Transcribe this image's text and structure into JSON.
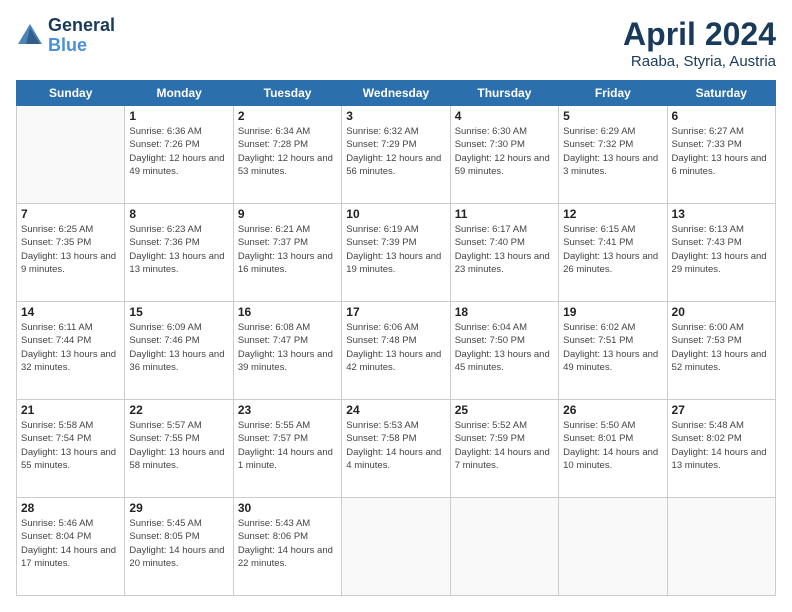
{
  "header": {
    "logo_line1": "General",
    "logo_line2": "Blue",
    "month_title": "April 2024",
    "location": "Raaba, Styria, Austria"
  },
  "weekdays": [
    "Sunday",
    "Monday",
    "Tuesday",
    "Wednesday",
    "Thursday",
    "Friday",
    "Saturday"
  ],
  "weeks": [
    [
      {
        "day": null
      },
      {
        "day": "1",
        "sunrise": "Sunrise: 6:36 AM",
        "sunset": "Sunset: 7:26 PM",
        "daylight": "Daylight: 12 hours and 49 minutes."
      },
      {
        "day": "2",
        "sunrise": "Sunrise: 6:34 AM",
        "sunset": "Sunset: 7:28 PM",
        "daylight": "Daylight: 12 hours and 53 minutes."
      },
      {
        "day": "3",
        "sunrise": "Sunrise: 6:32 AM",
        "sunset": "Sunset: 7:29 PM",
        "daylight": "Daylight: 12 hours and 56 minutes."
      },
      {
        "day": "4",
        "sunrise": "Sunrise: 6:30 AM",
        "sunset": "Sunset: 7:30 PM",
        "daylight": "Daylight: 12 hours and 59 minutes."
      },
      {
        "day": "5",
        "sunrise": "Sunrise: 6:29 AM",
        "sunset": "Sunset: 7:32 PM",
        "daylight": "Daylight: 13 hours and 3 minutes."
      },
      {
        "day": "6",
        "sunrise": "Sunrise: 6:27 AM",
        "sunset": "Sunset: 7:33 PM",
        "daylight": "Daylight: 13 hours and 6 minutes."
      }
    ],
    [
      {
        "day": "7",
        "sunrise": "Sunrise: 6:25 AM",
        "sunset": "Sunset: 7:35 PM",
        "daylight": "Daylight: 13 hours and 9 minutes."
      },
      {
        "day": "8",
        "sunrise": "Sunrise: 6:23 AM",
        "sunset": "Sunset: 7:36 PM",
        "daylight": "Daylight: 13 hours and 13 minutes."
      },
      {
        "day": "9",
        "sunrise": "Sunrise: 6:21 AM",
        "sunset": "Sunset: 7:37 PM",
        "daylight": "Daylight: 13 hours and 16 minutes."
      },
      {
        "day": "10",
        "sunrise": "Sunrise: 6:19 AM",
        "sunset": "Sunset: 7:39 PM",
        "daylight": "Daylight: 13 hours and 19 minutes."
      },
      {
        "day": "11",
        "sunrise": "Sunrise: 6:17 AM",
        "sunset": "Sunset: 7:40 PM",
        "daylight": "Daylight: 13 hours and 23 minutes."
      },
      {
        "day": "12",
        "sunrise": "Sunrise: 6:15 AM",
        "sunset": "Sunset: 7:41 PM",
        "daylight": "Daylight: 13 hours and 26 minutes."
      },
      {
        "day": "13",
        "sunrise": "Sunrise: 6:13 AM",
        "sunset": "Sunset: 7:43 PM",
        "daylight": "Daylight: 13 hours and 29 minutes."
      }
    ],
    [
      {
        "day": "14",
        "sunrise": "Sunrise: 6:11 AM",
        "sunset": "Sunset: 7:44 PM",
        "daylight": "Daylight: 13 hours and 32 minutes."
      },
      {
        "day": "15",
        "sunrise": "Sunrise: 6:09 AM",
        "sunset": "Sunset: 7:46 PM",
        "daylight": "Daylight: 13 hours and 36 minutes."
      },
      {
        "day": "16",
        "sunrise": "Sunrise: 6:08 AM",
        "sunset": "Sunset: 7:47 PM",
        "daylight": "Daylight: 13 hours and 39 minutes."
      },
      {
        "day": "17",
        "sunrise": "Sunrise: 6:06 AM",
        "sunset": "Sunset: 7:48 PM",
        "daylight": "Daylight: 13 hours and 42 minutes."
      },
      {
        "day": "18",
        "sunrise": "Sunrise: 6:04 AM",
        "sunset": "Sunset: 7:50 PM",
        "daylight": "Daylight: 13 hours and 45 minutes."
      },
      {
        "day": "19",
        "sunrise": "Sunrise: 6:02 AM",
        "sunset": "Sunset: 7:51 PM",
        "daylight": "Daylight: 13 hours and 49 minutes."
      },
      {
        "day": "20",
        "sunrise": "Sunrise: 6:00 AM",
        "sunset": "Sunset: 7:53 PM",
        "daylight": "Daylight: 13 hours and 52 minutes."
      }
    ],
    [
      {
        "day": "21",
        "sunrise": "Sunrise: 5:58 AM",
        "sunset": "Sunset: 7:54 PM",
        "daylight": "Daylight: 13 hours and 55 minutes."
      },
      {
        "day": "22",
        "sunrise": "Sunrise: 5:57 AM",
        "sunset": "Sunset: 7:55 PM",
        "daylight": "Daylight: 13 hours and 58 minutes."
      },
      {
        "day": "23",
        "sunrise": "Sunrise: 5:55 AM",
        "sunset": "Sunset: 7:57 PM",
        "daylight": "Daylight: 14 hours and 1 minute."
      },
      {
        "day": "24",
        "sunrise": "Sunrise: 5:53 AM",
        "sunset": "Sunset: 7:58 PM",
        "daylight": "Daylight: 14 hours and 4 minutes."
      },
      {
        "day": "25",
        "sunrise": "Sunrise: 5:52 AM",
        "sunset": "Sunset: 7:59 PM",
        "daylight": "Daylight: 14 hours and 7 minutes."
      },
      {
        "day": "26",
        "sunrise": "Sunrise: 5:50 AM",
        "sunset": "Sunset: 8:01 PM",
        "daylight": "Daylight: 14 hours and 10 minutes."
      },
      {
        "day": "27",
        "sunrise": "Sunrise: 5:48 AM",
        "sunset": "Sunset: 8:02 PM",
        "daylight": "Daylight: 14 hours and 13 minutes."
      }
    ],
    [
      {
        "day": "28",
        "sunrise": "Sunrise: 5:46 AM",
        "sunset": "Sunset: 8:04 PM",
        "daylight": "Daylight: 14 hours and 17 minutes."
      },
      {
        "day": "29",
        "sunrise": "Sunrise: 5:45 AM",
        "sunset": "Sunset: 8:05 PM",
        "daylight": "Daylight: 14 hours and 20 minutes."
      },
      {
        "day": "30",
        "sunrise": "Sunrise: 5:43 AM",
        "sunset": "Sunset: 8:06 PM",
        "daylight": "Daylight: 14 hours and 22 minutes."
      },
      {
        "day": null
      },
      {
        "day": null
      },
      {
        "day": null
      },
      {
        "day": null
      }
    ]
  ]
}
